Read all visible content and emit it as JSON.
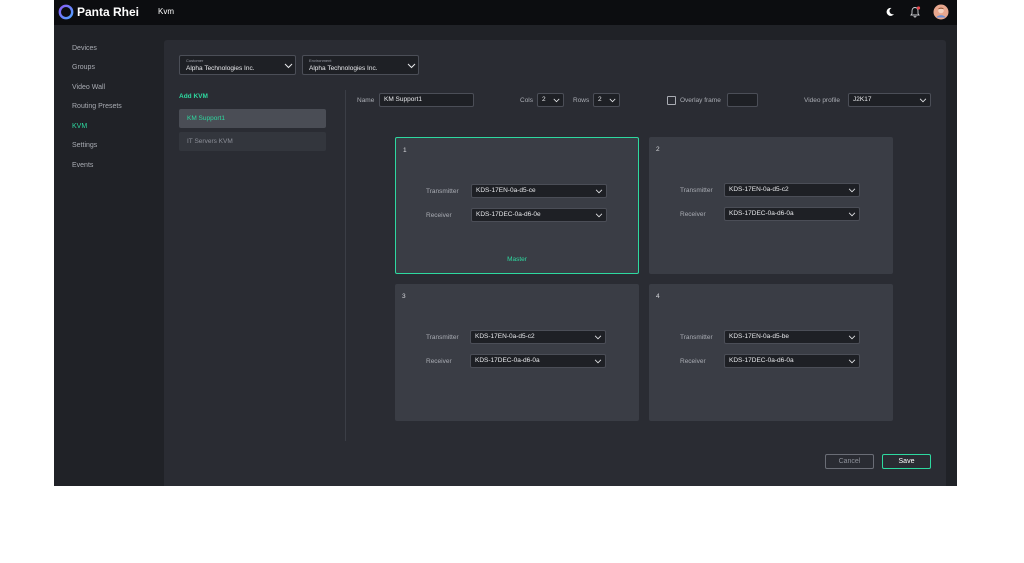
{
  "app": {
    "brand": "Panta Rhei",
    "breadcrumb": "Kvm"
  },
  "colors": {
    "accent": "#2ed9a0",
    "background": "#202227",
    "panel": "#2a2c33",
    "cell": "#3a3d45",
    "notification": "#e5484d"
  },
  "header_icons": [
    "moon-icon",
    "bell-icon",
    "avatar"
  ],
  "sidebar": {
    "items": [
      {
        "label": "Devices",
        "active": false
      },
      {
        "label": "Groups",
        "active": false
      },
      {
        "label": "Video Wall",
        "active": false
      },
      {
        "label": "Routing Presets",
        "active": false
      },
      {
        "label": "KVM",
        "active": true
      },
      {
        "label": "Settings",
        "active": false
      },
      {
        "label": "Events",
        "active": false
      }
    ]
  },
  "filters": {
    "customer": {
      "caption": "Customer",
      "value": "Alpha Technologies Inc."
    },
    "environment": {
      "caption": "Environment",
      "value": "Alpha Technologies Inc."
    }
  },
  "kvm_list": {
    "add_label": "Add KVM",
    "items": [
      {
        "label": "KM Support1",
        "selected": true
      },
      {
        "label": "IT Servers KVM",
        "selected": false
      }
    ]
  },
  "editor": {
    "name_label": "Name",
    "name_value": "KM Support1",
    "cols_label": "Cols",
    "cols_value": "2",
    "rows_label": "Rows",
    "rows_value": "2",
    "overlay_label": "Overlay frame",
    "overlay_checked": false,
    "overlay_value": "",
    "video_profile_label": "Video profile",
    "video_profile_value": "J2K17"
  },
  "cells": [
    {
      "number": "1",
      "transmitter_label": "Transmitter",
      "transmitter": "KDS-17EN-0a-d5-ce",
      "receiver_label": "Receiver",
      "receiver": "KDS-17DEC-0a-d6-0e",
      "master_label": "Master"
    },
    {
      "number": "2",
      "transmitter_label": "Transmitter",
      "transmitter": "KDS-17EN-0a-d5-c2",
      "receiver_label": "Receiver",
      "receiver": "KDS-17DEC-0a-d6-0a",
      "master_label": ""
    },
    {
      "number": "3",
      "transmitter_label": "Transmitter",
      "transmitter": "KDS-17EN-0a-d5-c2",
      "receiver_label": "Receiver",
      "receiver": "KDS-17DEC-0a-d6-0a",
      "master_label": ""
    },
    {
      "number": "4",
      "transmitter_label": "Transmitter",
      "transmitter": "KDS-17EN-0a-d5-be",
      "receiver_label": "Receiver",
      "receiver": "KDS-17DEC-0a-d6-0a",
      "master_label": ""
    }
  ],
  "actions": {
    "cancel_label": "Cancel",
    "save_label": "Save"
  }
}
